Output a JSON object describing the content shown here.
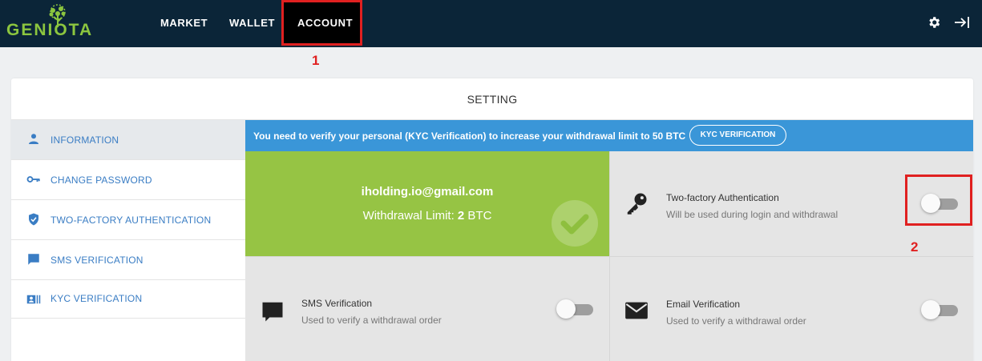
{
  "header": {
    "logo_text": "GENIOTA",
    "nav": {
      "market": "MARKET",
      "wallet": "WALLET",
      "account": "ACCOUNT"
    },
    "icons": [
      "gear-icon",
      "logout-icon"
    ]
  },
  "annotations": {
    "marker_1": "1",
    "marker_2": "2",
    "color": "#e02020"
  },
  "card": {
    "title": "SETTING"
  },
  "sidebar": {
    "items": [
      {
        "label": "INFORMATION",
        "icon": "user-icon",
        "active": true
      },
      {
        "label": "CHANGE PASSWORD",
        "icon": "key-icon",
        "active": false
      },
      {
        "label": "TWO-FACTORY AUTHENTICATION",
        "icon": "shield-icon",
        "active": false
      },
      {
        "label": "SMS VERIFICATION",
        "icon": "chat-icon",
        "active": false
      },
      {
        "label": "KYC VERIFICATION",
        "icon": "id-card-icon",
        "active": false
      }
    ]
  },
  "banner": {
    "text": "You need to verify your personal (KYC Verification) to increase your withdrawal limit to 50 BTC",
    "button": "KYC VERIFICATION",
    "color": "#3a96d8"
  },
  "account_info": {
    "email": "iholding.io@gmail.com",
    "limit_prefix": "Withdrawal Limit: ",
    "limit_value": "2",
    "limit_unit": " BTC",
    "color": "#96c444"
  },
  "settings": {
    "two_factor": {
      "title": "Two-factory Authentication",
      "desc": "Will be used during login and withdrawal",
      "enabled": false
    },
    "sms": {
      "title": "SMS Verification",
      "desc": "Used to verify a withdrawal order",
      "enabled": false
    },
    "email": {
      "title": "Email Verification",
      "desc": "Used to verify a withdrawal order",
      "enabled": false
    }
  }
}
